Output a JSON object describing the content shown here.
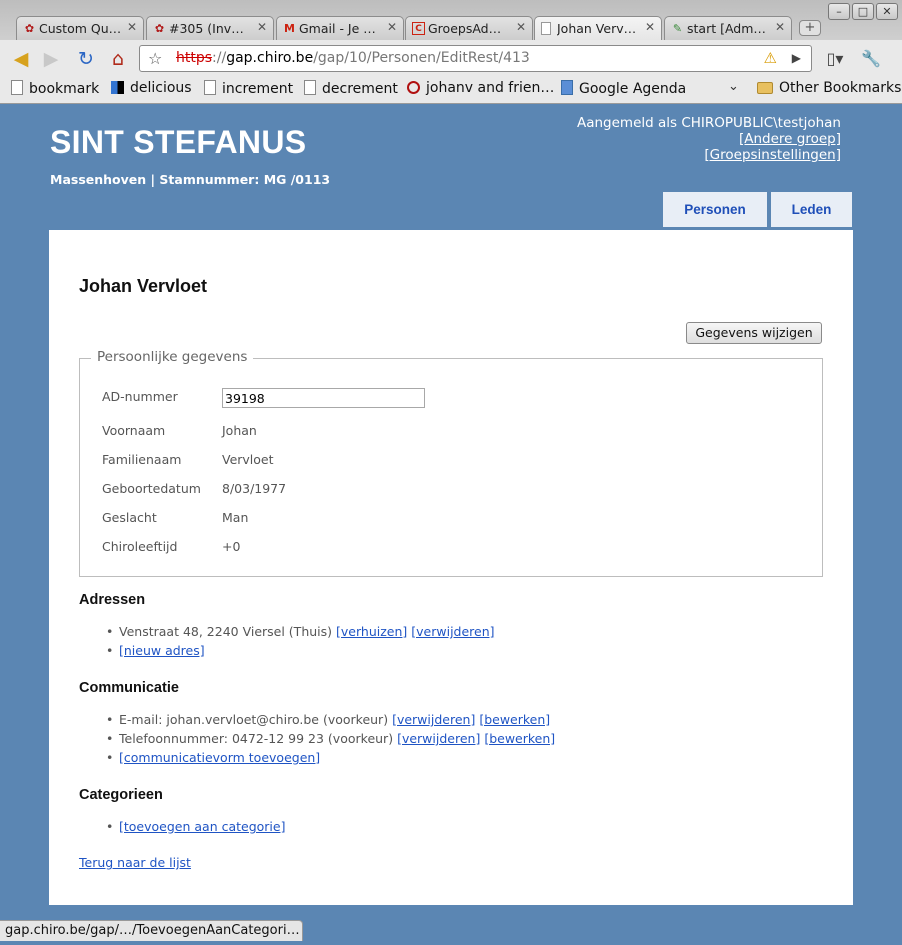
{
  "browser": {
    "tabs": [
      {
        "label": "Custom Qu…",
        "icon": "paw-icon"
      },
      {
        "label": "#305 (Inv…",
        "icon": "paw-icon"
      },
      {
        "label": "Gmail - Je …",
        "icon": "gmail-icon"
      },
      {
        "label": "GroepsAd…",
        "icon": "groepsadmin-icon"
      },
      {
        "label": "Johan Verv…",
        "icon": "page-icon"
      },
      {
        "label": "start [Adm…",
        "icon": "wiki-icon"
      }
    ],
    "url": {
      "scheme": "https",
      "host": "gap.chiro.be",
      "path": "/gap/10/Personen/EditRest/413"
    },
    "bookmarks": [
      {
        "label": "bookmark",
        "icon": "page-icon"
      },
      {
        "label": "delicious",
        "icon": "delicious-icon"
      },
      {
        "label": "increment",
        "icon": "page-icon"
      },
      {
        "label": "decrement",
        "icon": "page-icon"
      },
      {
        "label": "johanv and frien…",
        "icon": "quoraring-icon"
      },
      {
        "label": "Google Agenda",
        "icon": "calendar-icon"
      }
    ],
    "other_bookmarks": "Other Bookmarks",
    "status_url": "gap.chiro.be/gap/…/ToevoegenAanCategori…"
  },
  "site": {
    "title": "SINT STEFANUS",
    "subtitle": "Massenhoven | Stamnummer: MG /0113",
    "logged_in": "Aangemeld als CHIROPUBLIC\\testjohan",
    "other_group": "[Andere groep]",
    "group_settings": "[Groepsinstellingen]",
    "nav": {
      "personen": "Personen",
      "leden": "Leden"
    }
  },
  "person": {
    "name": "Johan Vervloet",
    "edit_button": "Gegevens wijzigen",
    "legend": "Persoonlijke gegevens",
    "fields": {
      "ad_label": "AD-nummer",
      "ad_value": "39198",
      "voornaam_label": "Voornaam",
      "voornaam_value": "Johan",
      "familienaam_label": "Familienaam",
      "familienaam_value": "Vervloet",
      "geboortedatum_label": "Geboortedatum",
      "geboortedatum_value": "8/03/1977",
      "geslacht_label": "Geslacht",
      "geslacht_value": "Man",
      "chiroleeftijd_label": "Chiroleeftijd",
      "chiroleeftijd_value": "+0"
    }
  },
  "adressen": {
    "heading": "Adressen",
    "address": "Venstraat 48, 2240 Viersel (Thuis)",
    "move": "[verhuizen]",
    "remove": "[verwijderen]",
    "new": "[nieuw adres]"
  },
  "communicatie": {
    "heading": "Communicatie",
    "email": "E-mail: johan.vervloet@chiro.be (voorkeur)",
    "phone": "Telefoonnummer: 0472-12 99 23 (voorkeur)",
    "remove": "[verwijderen]",
    "edit": "[bewerken]",
    "add": "[communicatievorm toevoegen]"
  },
  "categorieen": {
    "heading": "Categorieen",
    "add": "[toevoegen aan categorie]"
  },
  "back_link": "Terug naar de lijst"
}
